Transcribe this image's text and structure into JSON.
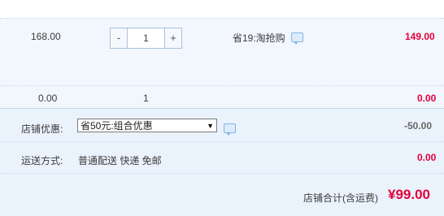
{
  "item": {
    "unit_price": "168.00",
    "quantity": "1",
    "decrement_label": "-",
    "increment_label": "+",
    "promotion": "省19:淘抢购",
    "total": "149.00"
  },
  "summary": {
    "price": "0.00",
    "quantity": "1",
    "total": "0.00"
  },
  "store_discount": {
    "label": "店铺优惠:",
    "selected": "省50元:组合优惠",
    "amount": "-50.00"
  },
  "shipping": {
    "label": "运送方式:",
    "options": "普通配送 快递 免邮",
    "amount": "0.00"
  },
  "store_total": {
    "label": "店铺合计(含运费)",
    "amount": "¥99.00"
  },
  "colors": {
    "price_red": "#e4003a",
    "row_bg": "#f2f6fd",
    "border_blue": "#a8c1dc"
  }
}
